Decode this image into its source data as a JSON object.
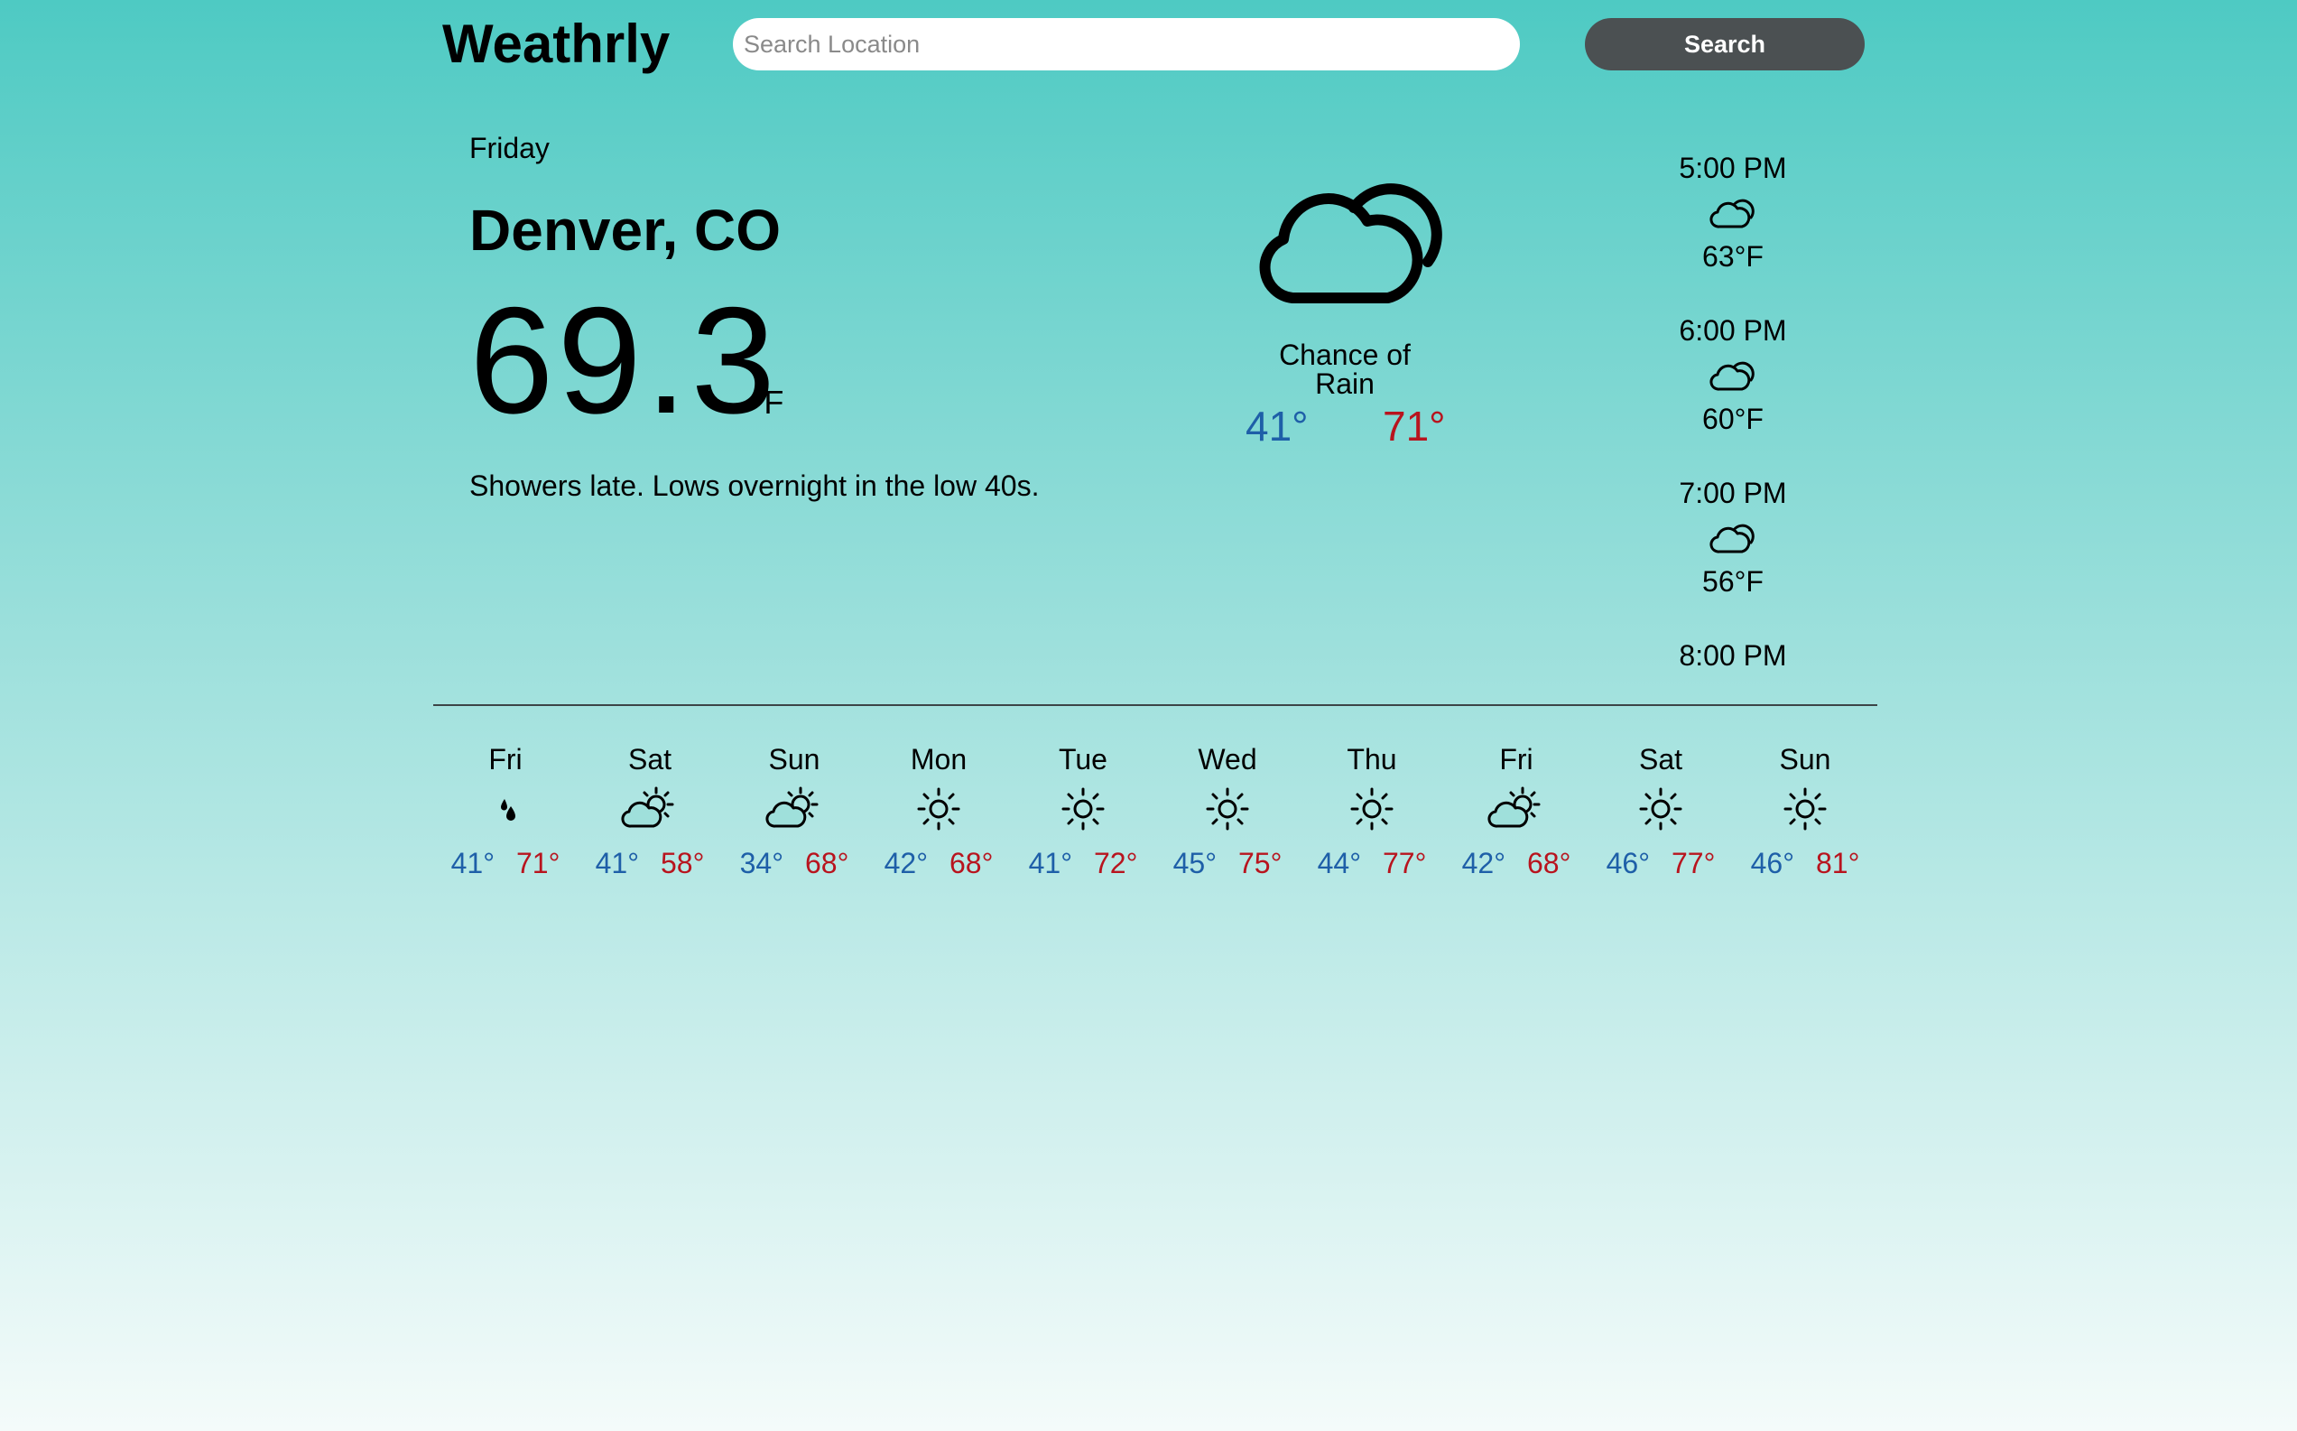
{
  "header": {
    "logo": "Weathrly",
    "search_placeholder": "Search Location",
    "search_label": "Search"
  },
  "current": {
    "day": "Friday",
    "city": "Denver, CO",
    "temp": "69.3",
    "unit": "°F",
    "description": "Showers late. Lows overnight in the low 40s.",
    "icon": "cloudy-icon",
    "summary": "Chance of Rain",
    "low": "41°",
    "high": "71°"
  },
  "hourly": [
    {
      "time": "5:00 PM",
      "icon": "cloudy-icon",
      "temp": "63°F"
    },
    {
      "time": "6:00 PM",
      "icon": "cloudy-icon",
      "temp": "60°F"
    },
    {
      "time": "7:00 PM",
      "icon": "cloudy-icon",
      "temp": "56°F"
    },
    {
      "time": "8:00 PM",
      "icon": "cloudy-icon",
      "temp": ""
    }
  ],
  "daily": [
    {
      "day": "Fri",
      "icon": "rain-drops-icon",
      "low": "41°",
      "high": "71°"
    },
    {
      "day": "Sat",
      "icon": "partly-cloudy-icon",
      "low": "41°",
      "high": "58°"
    },
    {
      "day": "Sun",
      "icon": "partly-cloudy-icon",
      "low": "34°",
      "high": "68°"
    },
    {
      "day": "Mon",
      "icon": "sun-icon",
      "low": "42°",
      "high": "68°"
    },
    {
      "day": "Tue",
      "icon": "sun-icon",
      "low": "41°",
      "high": "72°"
    },
    {
      "day": "Wed",
      "icon": "sun-icon",
      "low": "45°",
      "high": "75°"
    },
    {
      "day": "Thu",
      "icon": "sun-icon",
      "low": "44°",
      "high": "77°"
    },
    {
      "day": "Fri",
      "icon": "partly-cloudy-icon",
      "low": "42°",
      "high": "68°"
    },
    {
      "day": "Sat",
      "icon": "sun-icon",
      "low": "46°",
      "high": "77°"
    },
    {
      "day": "Sun",
      "icon": "sun-icon",
      "low": "46°",
      "high": "81°"
    }
  ],
  "colors": {
    "low": "#1e5fa8",
    "high": "#b8141e",
    "button": "#4b5052"
  }
}
